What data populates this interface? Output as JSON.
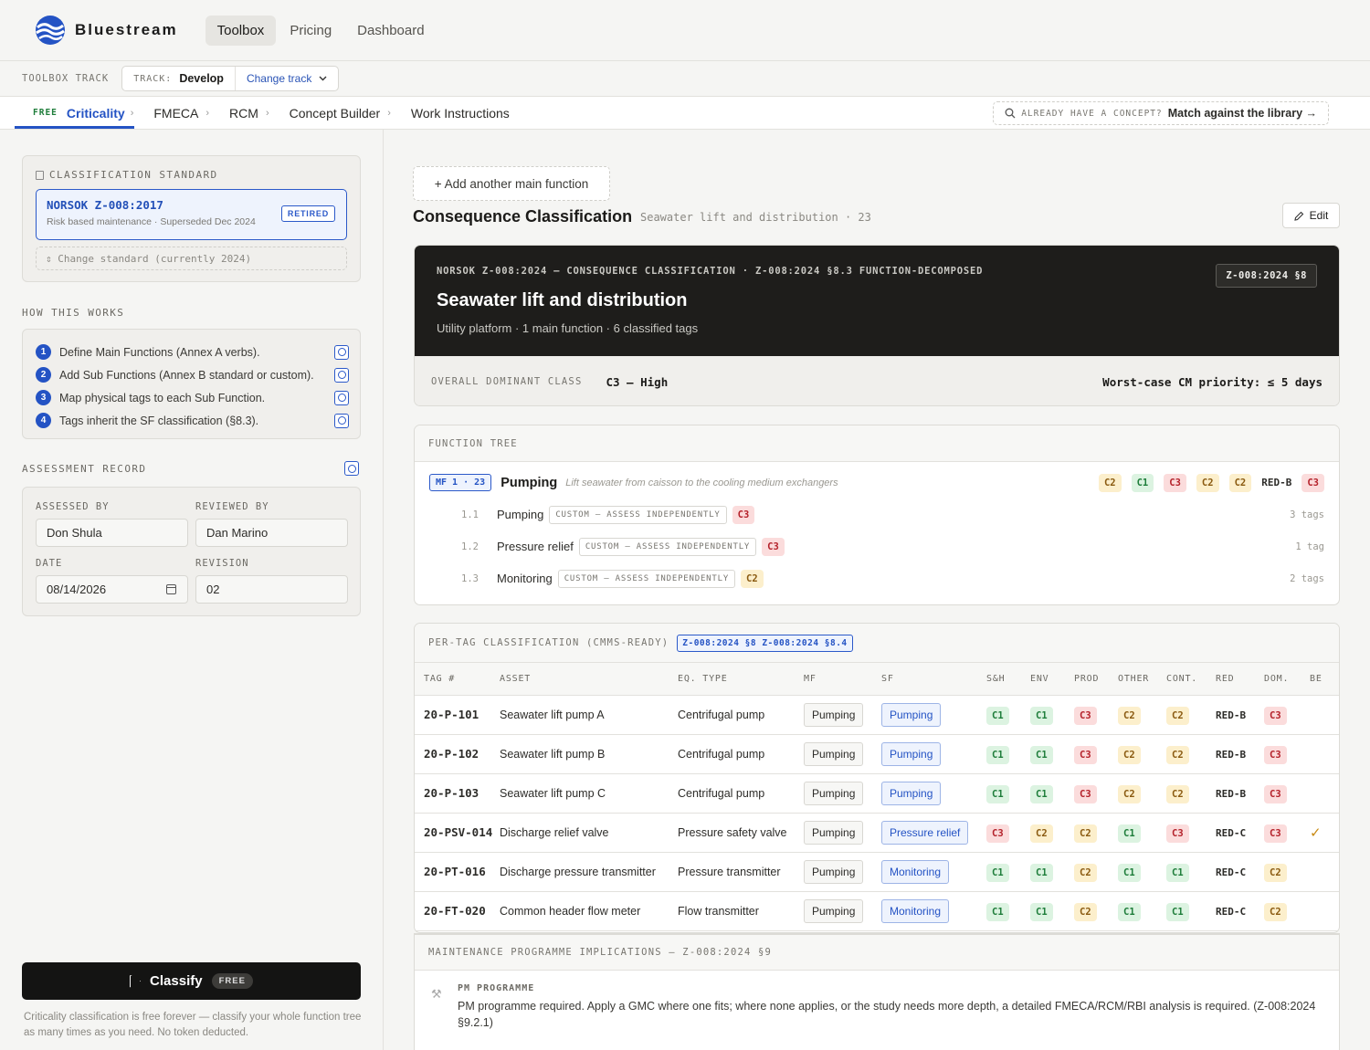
{
  "brand": {
    "name": "Bluestream"
  },
  "nav": {
    "items": [
      "Toolbox",
      "Pricing",
      "Dashboard"
    ],
    "active": "Toolbox"
  },
  "trackbar": {
    "label": "TOOLBOX TRACK",
    "track_key": "TRACK:",
    "track_value": "Develop",
    "change_label": "Change track"
  },
  "crumbs": {
    "free_tag": "FREE",
    "items": [
      "Criticality",
      "FMECA",
      "RCM",
      "Concept Builder",
      "Work Instructions"
    ],
    "active": "Criticality"
  },
  "match": {
    "key": "ALREADY HAVE A CONCEPT?",
    "value": "Match against the library →"
  },
  "sidebar": {
    "standard": {
      "title": "CLASSIFICATION STANDARD",
      "selected_name": "NORSOK Z-008:2017",
      "selected_sub": "Risk based maintenance · Superseded Dec 2024",
      "badge": "RETIRED",
      "change": "⇕ Change standard (currently 2024)"
    },
    "how": {
      "title": "HOW THIS WORKS",
      "steps": [
        {
          "num": "1",
          "text": "Define Main Functions (Annex A verbs)."
        },
        {
          "num": "2",
          "text": "Add Sub Functions (Annex B standard or custom)."
        },
        {
          "num": "3",
          "text": "Map physical tags to each Sub Function."
        },
        {
          "num": "4",
          "text": "Tags inherit the SF classification (§8.3)."
        }
      ]
    },
    "record": {
      "title": "ASSESSMENT RECORD",
      "assessed_label": "ASSESSED BY",
      "assessed_value": "Don Shula",
      "reviewed_label": "REVIEWED BY",
      "reviewed_value": "Dan Marino",
      "date_label": "DATE",
      "date_value": "08/14/2026",
      "revision_label": "REVISION",
      "revision_value": "02"
    },
    "classify": {
      "label": "Classify",
      "badge": "FREE",
      "note": "Criticality classification is free forever — classify your whole function tree as many times as you need. No token deducted."
    }
  },
  "main": {
    "add_function": "+ Add another main function",
    "title": "Consequence Classification",
    "subtitle": "Seawater lift and distribution · 23",
    "edit_label": "Edit",
    "hero": {
      "kicker": "NORSOK Z-008:2024 — CONSEQUENCE CLASSIFICATION · Z-008:2024 §8.3 FUNCTION-DECOMPOSED",
      "title": "Seawater lift and distribution",
      "sub": "Utility platform · 1 main function · 6 classified tags",
      "badge": "Z-008:2024 §8",
      "overall_key": "OVERALL DOMINANT CLASS",
      "overall_value": "C3 — High",
      "worst_case": "Worst-case CM priority: ≤ 5 days"
    },
    "function_tree": {
      "title": "FUNCTION TREE",
      "mf_tag": "MF 1 · 23",
      "mf_name": "Pumping",
      "mf_desc": "Lift seawater from caisson to the cooling medium exchangers",
      "mf_chips": [
        "C2",
        "C1",
        "C3",
        "C2",
        "C2",
        "RED-B",
        "C3"
      ],
      "subs": [
        {
          "num": "1.1",
          "name": "Pumping",
          "custom": "CUSTOM — ASSESS INDEPENDENTLY",
          "cls": "C3",
          "count": "3 tags"
        },
        {
          "num": "1.2",
          "name": "Pressure relief",
          "custom": "CUSTOM — ASSESS INDEPENDENTLY",
          "cls": "C3",
          "count": "1 tag"
        },
        {
          "num": "1.3",
          "name": "Monitoring",
          "custom": "CUSTOM — ASSESS INDEPENDENTLY",
          "cls": "C2",
          "count": "2 tags"
        }
      ]
    },
    "per_tag": {
      "title": "PER-TAG CLASSIFICATION (CMMS-READY)",
      "ref": "Z-008:2024 §8 Z-008:2024 §8.4",
      "headers": [
        "TAG #",
        "ASSET",
        "EQ. TYPE",
        "MF",
        "SF",
        "S&H",
        "ENV",
        "PROD",
        "OTHER",
        "CONT.",
        "RED",
        "DOM.",
        "BE"
      ],
      "rows": [
        {
          "tag": "20-P-101",
          "asset": "Seawater lift pump A",
          "eq": "Centrifugal pump",
          "mf": "Pumping",
          "sf": "Pumping",
          "sh": "C1",
          "env": "C1",
          "prod": "C3",
          "other": "C2",
          "cont": "C2",
          "red": "RED-B",
          "dom": "C3",
          "be": ""
        },
        {
          "tag": "20-P-102",
          "asset": "Seawater lift pump B",
          "eq": "Centrifugal pump",
          "mf": "Pumping",
          "sf": "Pumping",
          "sh": "C1",
          "env": "C1",
          "prod": "C3",
          "other": "C2",
          "cont": "C2",
          "red": "RED-B",
          "dom": "C3",
          "be": ""
        },
        {
          "tag": "20-P-103",
          "asset": "Seawater lift pump C",
          "eq": "Centrifugal pump",
          "mf": "Pumping",
          "sf": "Pumping",
          "sh": "C1",
          "env": "C1",
          "prod": "C3",
          "other": "C2",
          "cont": "C2",
          "red": "RED-B",
          "dom": "C3",
          "be": ""
        },
        {
          "tag": "20-PSV-014",
          "asset": "Discharge relief valve",
          "eq": "Pressure safety valve",
          "mf": "Pumping",
          "sf": "Pressure relief",
          "sh": "C3",
          "env": "C2",
          "prod": "C2",
          "other": "C1",
          "cont": "C3",
          "red": "RED-C",
          "dom": "C3",
          "be": "✓"
        },
        {
          "tag": "20-PT-016",
          "asset": "Discharge pressure transmitter",
          "eq": "Pressure transmitter",
          "mf": "Pumping",
          "sf": "Monitoring",
          "sh": "C1",
          "env": "C1",
          "prod": "C2",
          "other": "C1",
          "cont": "C1",
          "red": "RED-C",
          "dom": "C2",
          "be": ""
        },
        {
          "tag": "20-FT-020",
          "asset": "Common header flow meter",
          "eq": "Flow transmitter",
          "mf": "Pumping",
          "sf": "Monitoring",
          "sh": "C1",
          "env": "C1",
          "prod": "C2",
          "other": "C1",
          "cont": "C1",
          "red": "RED-C",
          "dom": "C2",
          "be": ""
        }
      ]
    },
    "maintenance": {
      "title": "MAINTENANCE PROGRAMME IMPLICATIONS — Z-008:2024 §9",
      "pm_key": "PM PROGRAMME",
      "pm_text": "PM programme required. Apply a GMC where one fits; where none applies, or the study needs more depth, a detailed FMECA/RCM/RBI analysis is required. (Z-008:2024 §9.2.1)"
    }
  }
}
